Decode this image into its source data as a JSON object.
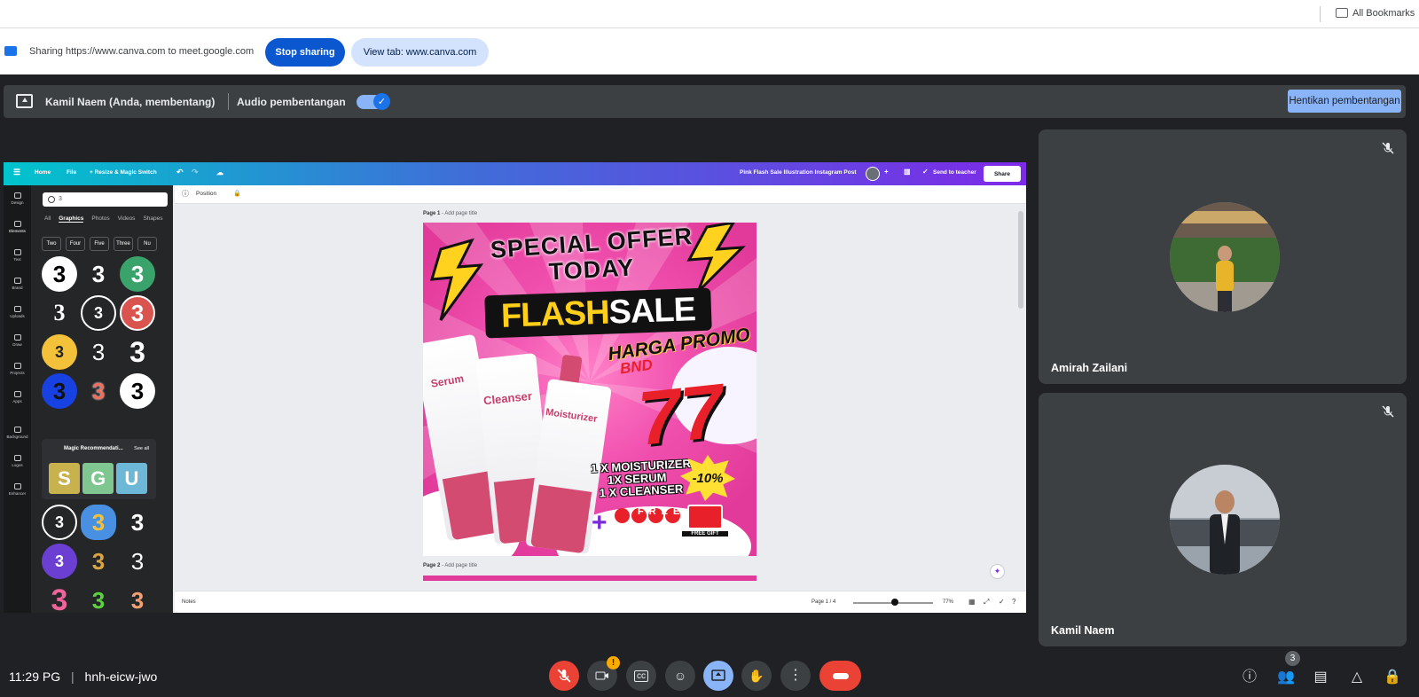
{
  "bookmarks": {
    "label": "All Bookmarks"
  },
  "sharebar": {
    "text": "Sharing https://www.canva.com to meet.google.com",
    "stop_label": "Stop sharing",
    "view_label": "View tab: www.canva.com"
  },
  "presenting": {
    "name": "Kamil Naem (Anda, membentang)",
    "audio_label": "Audio pembentangan",
    "audio_on": true,
    "stop_label": "Hentikan pembentangan"
  },
  "canva": {
    "menu": {
      "home": "Home",
      "file": "File",
      "resize": "+ Resize & Magic Switch"
    },
    "doc_title": "Pink Flash Sale Illustration Instagram Post",
    "send_label": "Send to teacher",
    "share_label": "Share",
    "rail": [
      "Design",
      "Elements",
      "Text",
      "Brand",
      "Uploads",
      "Draw",
      "Projects",
      "Apps",
      "Background",
      "Logos",
      "Enhancer"
    ],
    "search_value": "3",
    "tabs": [
      "All",
      "Graphics",
      "Photos",
      "Videos",
      "Shapes"
    ],
    "active_tab": "Graphics",
    "chips": [
      "Two",
      "Four",
      "Five",
      "Three",
      "Nu"
    ],
    "magic": {
      "title": "Magic Recommendati...",
      "see_all": "See all"
    },
    "toolbar_position": "Position",
    "page1_label": "Page 1",
    "page1_add": "- Add page title",
    "page2_label": "Page 2",
    "page2_add": "- Add page title",
    "design": {
      "line1": "SPECIAL OFFER",
      "line2": "TODAY",
      "flash": "FLASH",
      "sale": "SALE",
      "harga": "HARGA PROMO",
      "currency": "BND",
      "price": "77",
      "products": [
        "Serum",
        "Cleanser",
        "Moisturizer"
      ],
      "items": [
        "1 X MOISTURIZER",
        "1X SERUM",
        "1 X CLEANSER"
      ],
      "discount": "-10%",
      "free": "FREE",
      "gift": "FREE GIFT"
    },
    "notes_label": "Notes",
    "page_indicator": "Page 1 / 4",
    "zoom": "77%"
  },
  "participants": [
    {
      "name": "Amirah Zailani",
      "muted": true
    },
    {
      "name": "Kamil Naem",
      "muted": true
    }
  ],
  "bottombar": {
    "time": "11:29 PG",
    "meeting_code": "hnh-eicw-jwo",
    "warning_badge": "!",
    "people_count": "3"
  }
}
